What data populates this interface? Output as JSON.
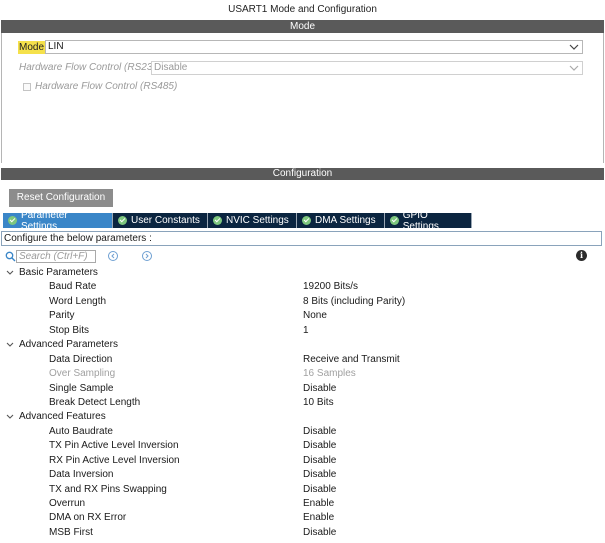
{
  "window": {
    "title": "USART1 Mode and Configuration"
  },
  "mode_section": {
    "header": "Mode",
    "mode_label": "Mode",
    "mode_value": "LIN",
    "hw_flow_rs232_label": "Hardware Flow Control (RS232)",
    "hw_flow_rs232_value": "Disable",
    "hw_flow_rs485_label": "Hardware Flow Control (RS485)"
  },
  "config_section": {
    "header": "Configuration",
    "reset_button": "Reset Configuration",
    "tabs": [
      {
        "label": "Parameter Settings",
        "active": true
      },
      {
        "label": "User Constants",
        "active": false
      },
      {
        "label": "NVIC Settings",
        "active": false
      },
      {
        "label": "DMA Settings",
        "active": false
      },
      {
        "label": "GPIO Settings",
        "active": false
      }
    ],
    "description": "Configure the below parameters :",
    "search_placeholder": "Search (Ctrl+F)",
    "groups": [
      {
        "name": "Basic Parameters",
        "params": [
          {
            "name": "Baud Rate",
            "value": "19200 Bits/s"
          },
          {
            "name": "Word Length",
            "value": "8 Bits (including Parity)"
          },
          {
            "name": "Parity",
            "value": "None"
          },
          {
            "name": "Stop Bits",
            "value": "1"
          }
        ]
      },
      {
        "name": "Advanced Parameters",
        "params": [
          {
            "name": "Data Direction",
            "value": "Receive and Transmit"
          },
          {
            "name": "Over Sampling",
            "value": "16 Samples",
            "disabled": true
          },
          {
            "name": "Single Sample",
            "value": "Disable"
          },
          {
            "name": "Break Detect Length",
            "value": "10 Bits"
          }
        ]
      },
      {
        "name": "Advanced Features",
        "params": [
          {
            "name": "Auto Baudrate",
            "value": "Disable"
          },
          {
            "name": "TX Pin Active Level Inversion",
            "value": "Disable"
          },
          {
            "name": "RX Pin Active Level Inversion",
            "value": "Disable"
          },
          {
            "name": "Data Inversion",
            "value": "Disable"
          },
          {
            "name": "TX and RX Pins Swapping",
            "value": "Disable"
          },
          {
            "name": "Overrun",
            "value": "Enable"
          },
          {
            "name": "DMA on RX Error",
            "value": "Enable"
          },
          {
            "name": "MSB First",
            "value": "Disable"
          }
        ]
      }
    ]
  },
  "colors": {
    "section_header_bg": "#5a5a5a",
    "tab_bg": "#0b2540",
    "tab_active_bg": "#3a86c8",
    "mode_highlight": "#f5e14b",
    "check_green": "#7ec77e"
  }
}
